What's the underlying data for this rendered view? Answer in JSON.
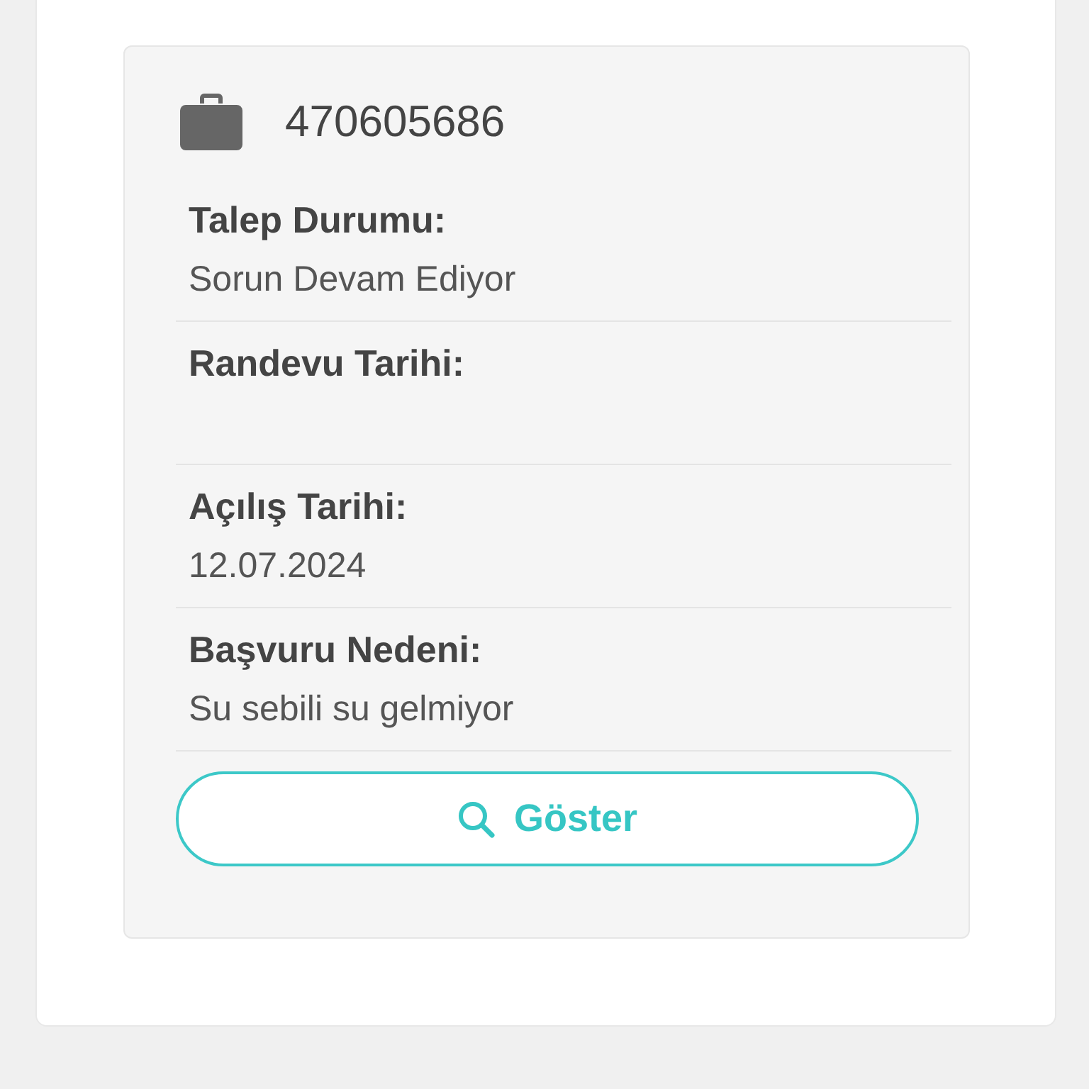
{
  "request": {
    "number": "470605686",
    "fields": [
      {
        "label": "Talep Durumu:",
        "value": "Sorun Devam Ediyor"
      },
      {
        "label": "Randevu Tarihi:"
      },
      {
        "label": "Açılış Tarihi:",
        "value": "12.07.2024"
      },
      {
        "label": "Başvuru Nedeni:",
        "value": "Su sebili su gelmiyor"
      }
    ],
    "button": "Göster"
  }
}
